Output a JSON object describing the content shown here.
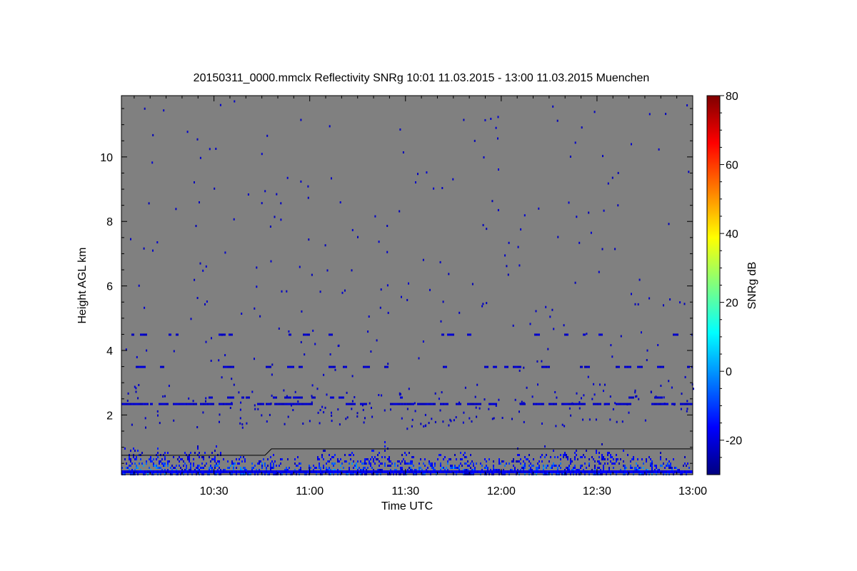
{
  "chart_data": {
    "type": "heatmap",
    "title": "20150311_0000.mmclx Reflectivity SNRg   10:01 11.03.2015 - 13:00 11.03.2015 Muenchen",
    "xlabel": "Time UTC",
    "ylabel": "Height AGL km",
    "colorbar_label": "SNRg dB",
    "x_ticks": [
      "10:30",
      "11:00",
      "11:30",
      "12:00",
      "12:30",
      "13:00"
    ],
    "x_tick_minutes": [
      630,
      660,
      690,
      720,
      750,
      780
    ],
    "xlim_minutes": [
      601,
      780
    ],
    "y_ticks": [
      2,
      4,
      6,
      8,
      10
    ],
    "ylim": [
      0.15,
      11.9
    ],
    "colorbar_ticks": [
      -20,
      0,
      20,
      40,
      60,
      80
    ],
    "colorbar_range": [
      -30,
      80
    ],
    "colors": {
      "background": "#808080",
      "colormap": [
        "#00007f",
        "#0000ff",
        "#007fff",
        "#00ffff",
        "#7fff7f",
        "#ffff00",
        "#ff7f00",
        "#ff0000",
        "#7f0000"
      ]
    },
    "features": {
      "boundary_layer_top_km": 1.6,
      "cloud_band_heights_km": [
        2.35,
        2.55,
        3.5,
        4.5
      ]
    }
  }
}
